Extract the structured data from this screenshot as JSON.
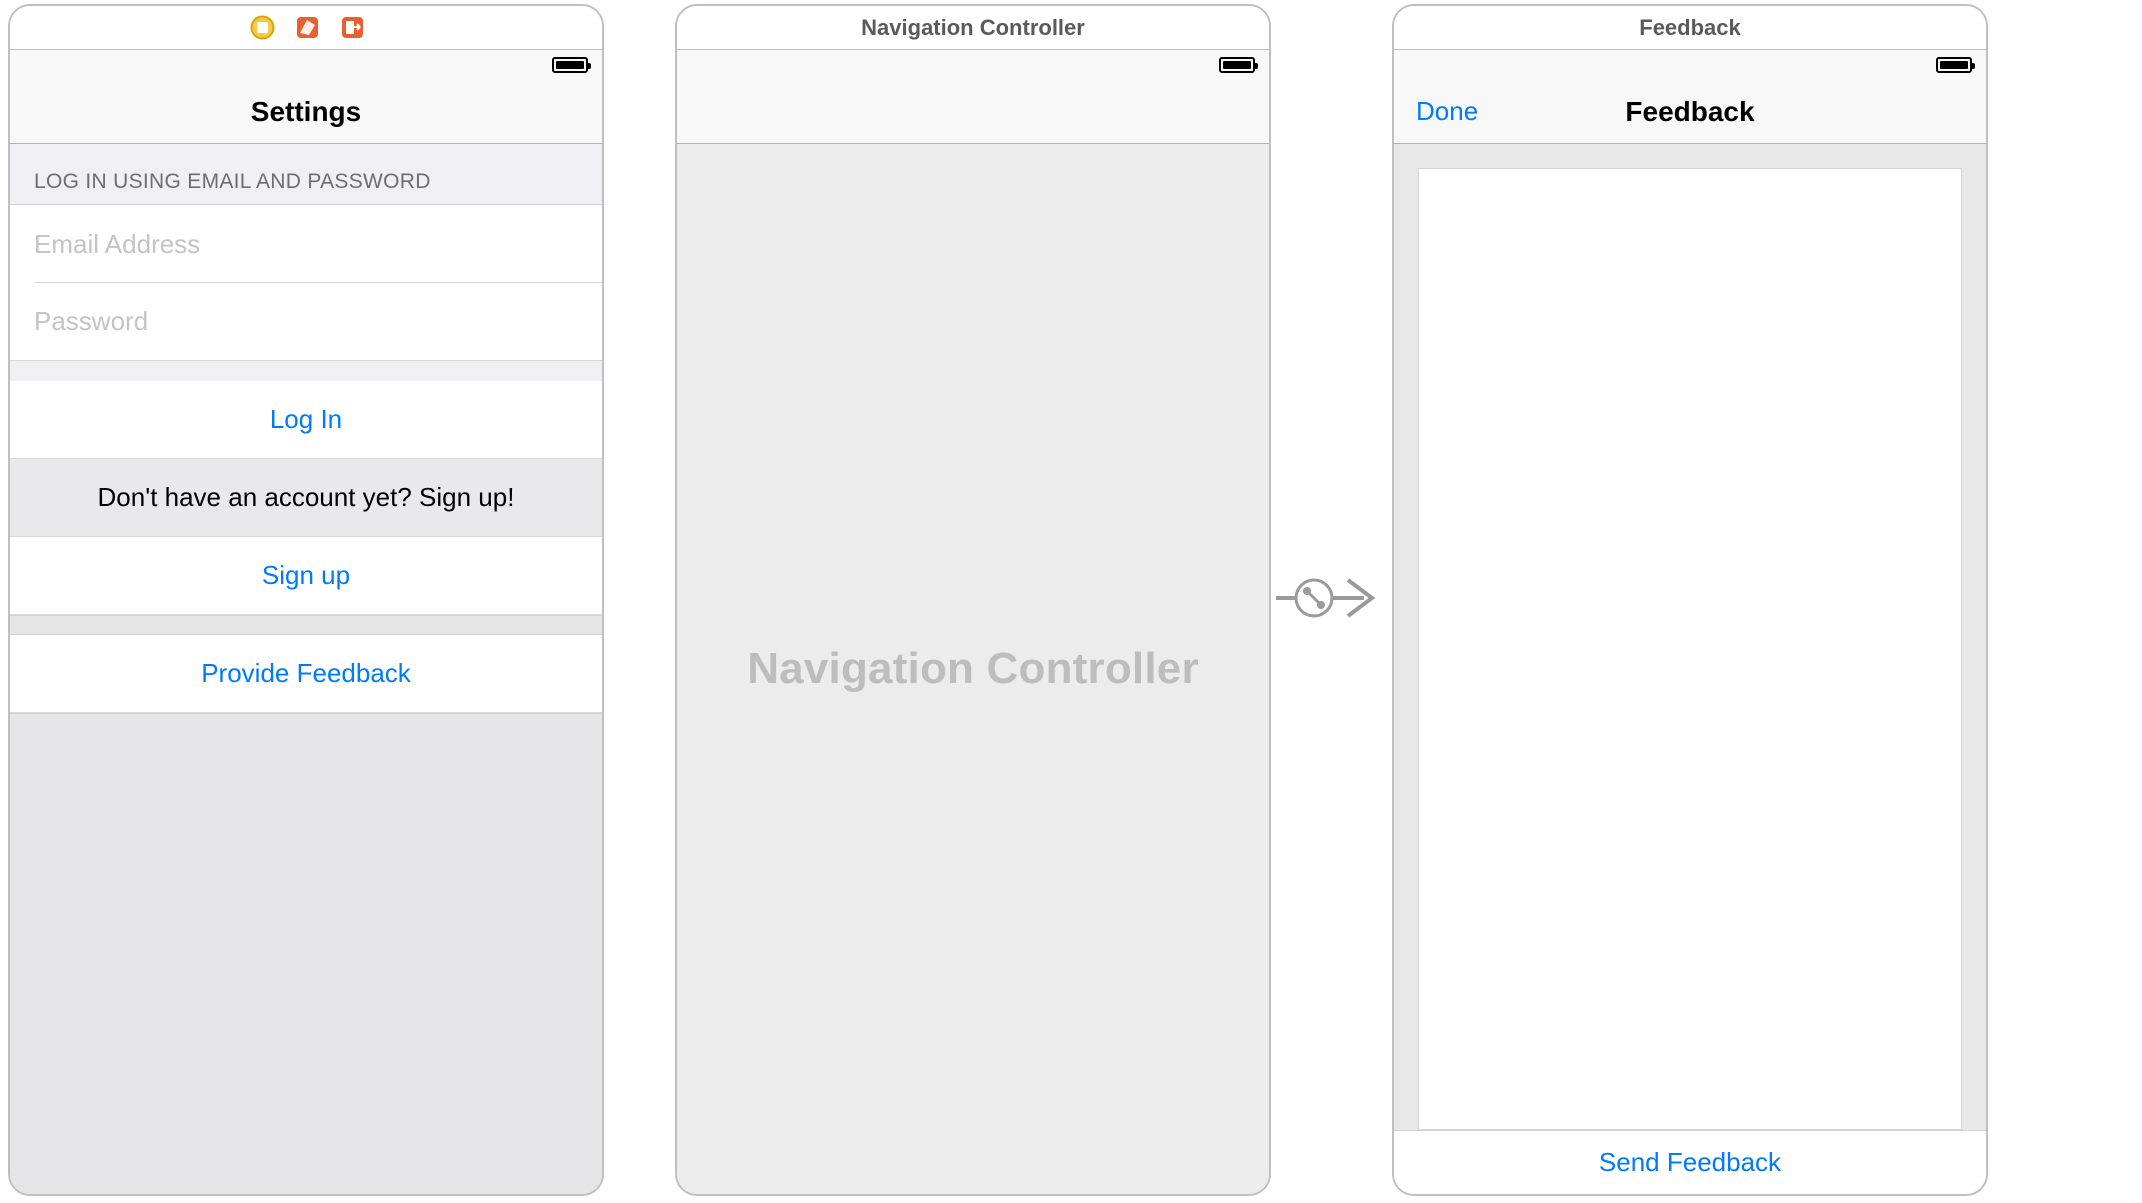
{
  "scenes": {
    "settings": {
      "nav_title": "Settings",
      "section1_header": "LOG IN USING EMAIL AND PASSWORD",
      "email_placeholder": "Email Address",
      "password_placeholder": "Password",
      "login_label": "Log In",
      "signup_prompt": "Don't have an account yet? Sign up!",
      "signup_label": "Sign up",
      "feedback_label": "Provide Feedback"
    },
    "navcontroller": {
      "scene_title": "Navigation Controller",
      "placeholder_label": "Navigation Controller"
    },
    "feedback": {
      "scene_title": "Feedback",
      "nav_left": "Done",
      "nav_title": "Feedback",
      "send_label": "Send Feedback"
    }
  }
}
